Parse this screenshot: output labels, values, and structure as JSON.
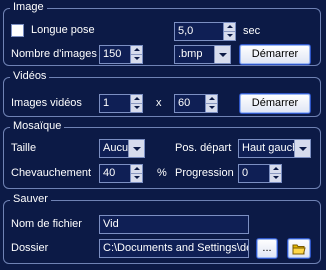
{
  "image": {
    "legend": "Image",
    "longue_pose_label": "Longue pose",
    "longue_pose_checked": false,
    "exposure_value": "5,0",
    "exposure_unit": "sec",
    "nombre_images_label": "Nombre d'images",
    "nombre_images_value": "150",
    "format_value": ".bmp",
    "start_button": "Démarrer"
  },
  "videos": {
    "legend": "Vidéos",
    "images_videos_label": "Images vidéos",
    "width_value": "1",
    "x_label": "x",
    "height_value": "60",
    "start_button": "Démarrer"
  },
  "mosaique": {
    "legend": "Mosaïque",
    "taille_label": "Taille",
    "taille_value": "Aucun",
    "pos_depart_label": "Pos. départ",
    "pos_depart_value": "Haut gauche",
    "chevauchement_label": "Chevauchement",
    "chevauchement_value": "40",
    "percent_label": "%",
    "progression_label": "Progression",
    "progression_value": "0"
  },
  "sauver": {
    "legend": "Sauver",
    "nom_fichier_label": "Nom de fichier",
    "nom_fichier_value": "Vid",
    "dossier_label": "Dossier",
    "dossier_value": "C:\\Documents and Settings\\den",
    "browse_button": "..."
  }
}
